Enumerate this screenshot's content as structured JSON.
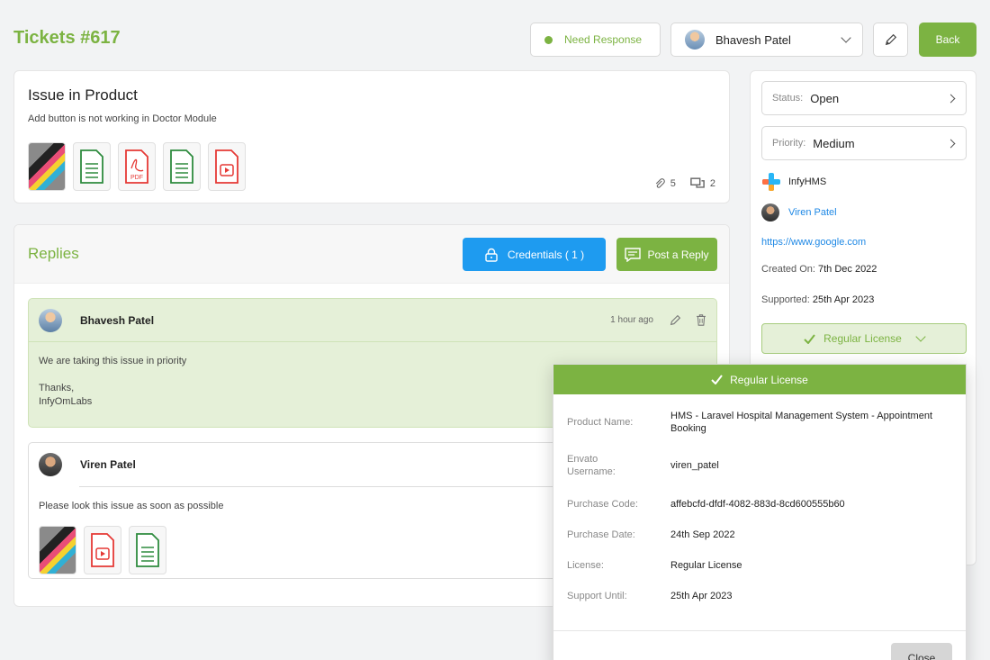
{
  "header": {
    "title": "Tickets #617",
    "need_response_label": "Need Response",
    "assignee_name": "Bhavesh Patel",
    "back_label": "Back"
  },
  "issue": {
    "title": "Issue in Product",
    "description": "Add button is not working in Doctor Module",
    "attachments": [
      "image",
      "doc",
      "pdf",
      "doc",
      "video"
    ],
    "attachment_count": "5",
    "reply_count": "2",
    "pdf_label": "PDF"
  },
  "replies": {
    "title": "Replies",
    "credentials_label": "Credentials ( 1 )",
    "post_reply_label": "Post a Reply",
    "items": [
      {
        "author": "Bhavesh Patel",
        "time": "1 hour ago",
        "body_line1": "We are taking this issue in priority",
        "body_line2": "Thanks,",
        "body_line3": "InfyOmLabs"
      },
      {
        "author": "Viren Patel",
        "body": "Please look this issue as soon as possible",
        "attachments": [
          "image",
          "video",
          "doc"
        ]
      }
    ]
  },
  "sidebar": {
    "status_label": "Status:",
    "status_value": "Open",
    "priority_label": "Priority:",
    "priority_value": "Medium",
    "product": "InfyHMS",
    "customer": "Viren Patel",
    "url": "https://www.google.com",
    "created_label": "Created On:",
    "created_value": "7th Dec 2022",
    "supported_label": "Supported:",
    "supported_value": "25th Apr 2023",
    "license_button": "Regular License"
  },
  "license_popup": {
    "title": "Regular License",
    "rows": [
      {
        "key": "Product Name:",
        "value": "HMS - Laravel Hospital Management System - Appointment Booking"
      },
      {
        "key": "Envato Username:",
        "value": "viren_patel"
      },
      {
        "key": "Purchase Code:",
        "value": "affebcfd-dfdf-4082-883d-8cd600555b60"
      },
      {
        "key": "Purchase Date:",
        "value": "24th Sep 2022"
      },
      {
        "key": "License:",
        "value": "Regular License"
      },
      {
        "key": "Support Until:",
        "value": "25th Apr 2023"
      }
    ],
    "close_label": "Close"
  },
  "colors": {
    "accent": "#7cb342",
    "blue": "#1e9bf0",
    "reply_highlight": "#e5f0d8"
  }
}
